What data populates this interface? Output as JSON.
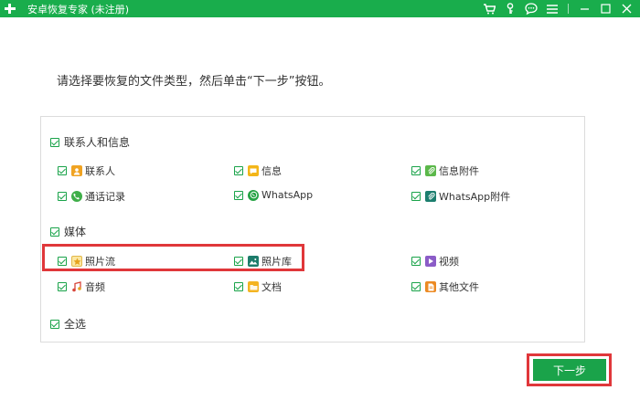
{
  "window": {
    "title": "安卓恢复专家 (未注册)"
  },
  "instruction": "请选择要恢复的文件类型，然后单击“下一步”按钮。",
  "sections": {
    "contacts": {
      "label": "联系人和信息",
      "items": [
        "联系人",
        "信息",
        "信息附件",
        "通话记录",
        "WhatsApp",
        "WhatsApp附件"
      ]
    },
    "media": {
      "label": "媒体",
      "items": [
        "照片流",
        "照片库",
        "视频",
        "音频",
        "文档",
        "其他文件"
      ]
    },
    "select_all": {
      "label": "全选"
    }
  },
  "next_button": {
    "label": "下一步"
  },
  "colors": {
    "brand_green": "#19ad4c",
    "highlight_red": "#e0373a"
  }
}
